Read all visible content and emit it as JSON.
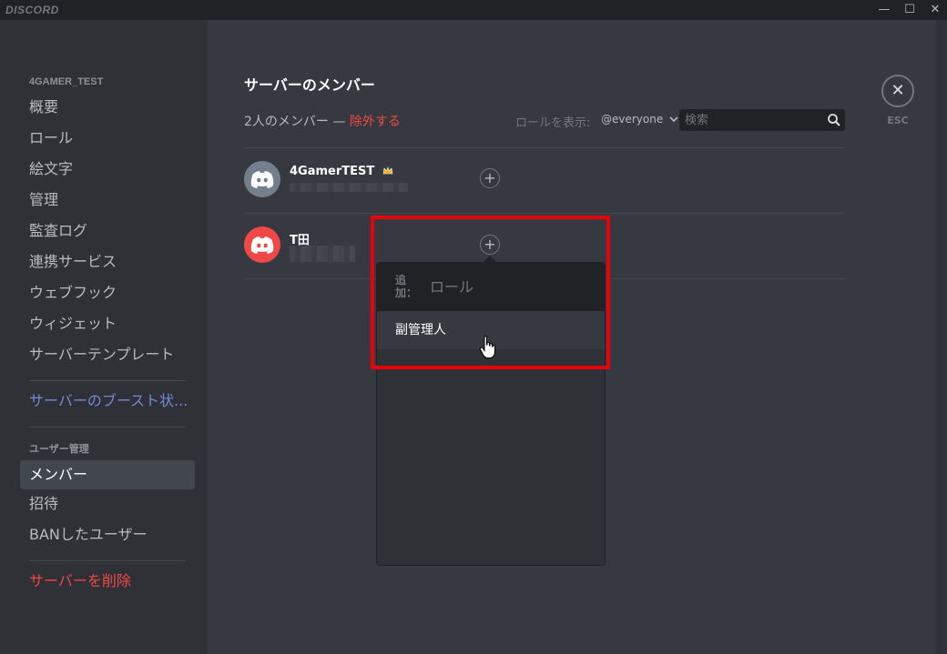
{
  "window": {
    "brand": "DISCORD",
    "minimize_glyph": "—",
    "maximize_glyph": "☐",
    "close_glyph": "✕"
  },
  "sidebar": {
    "server_name": "4GAMER_TEST",
    "items": [
      {
        "label": "概要"
      },
      {
        "label": "ロール"
      },
      {
        "label": "絵文字"
      },
      {
        "label": "管理"
      },
      {
        "label": "監査ログ"
      },
      {
        "label": "連携サービス"
      },
      {
        "label": "ウェブフック"
      },
      {
        "label": "ウィジェット"
      },
      {
        "label": "サーバーテンプレート"
      }
    ],
    "boost_label": "サーバーのブースト状...",
    "user_mgmt_header": "ユーザー管理",
    "user_mgmt_items": [
      {
        "label": "メンバー",
        "active": true
      },
      {
        "label": "招待"
      },
      {
        "label": "BANしたユーザー"
      }
    ],
    "delete_label": "サーバーを削除"
  },
  "main": {
    "title": "サーバーのメンバー",
    "member_count": "2人のメンバー",
    "count_separator": " — ",
    "prune_label": "除外する",
    "role_filter_label": "ロールを表示:",
    "role_filter_value": "@everyone",
    "search_placeholder": "検索",
    "members": [
      {
        "name": "4GamerTEST",
        "owner": true,
        "avatar_color": "#747f8d"
      },
      {
        "name": "T田",
        "owner": false,
        "avatar_color": "#f04747"
      }
    ],
    "add_role_glyph": "+"
  },
  "role_popout": {
    "add_label": "追加：",
    "role_placeholder": "ロール",
    "options": [
      {
        "label": "副管理人"
      }
    ]
  },
  "close": {
    "glyph": "✕",
    "esc_label": "ESC"
  },
  "colors": {
    "accent": "#7289da",
    "danger": "#f04747",
    "highlight_box": "#e8000b"
  },
  "icons": [
    "crown-icon",
    "search-icon",
    "chevron-down-icon",
    "discord-logo-icon",
    "hand-cursor-icon"
  ]
}
